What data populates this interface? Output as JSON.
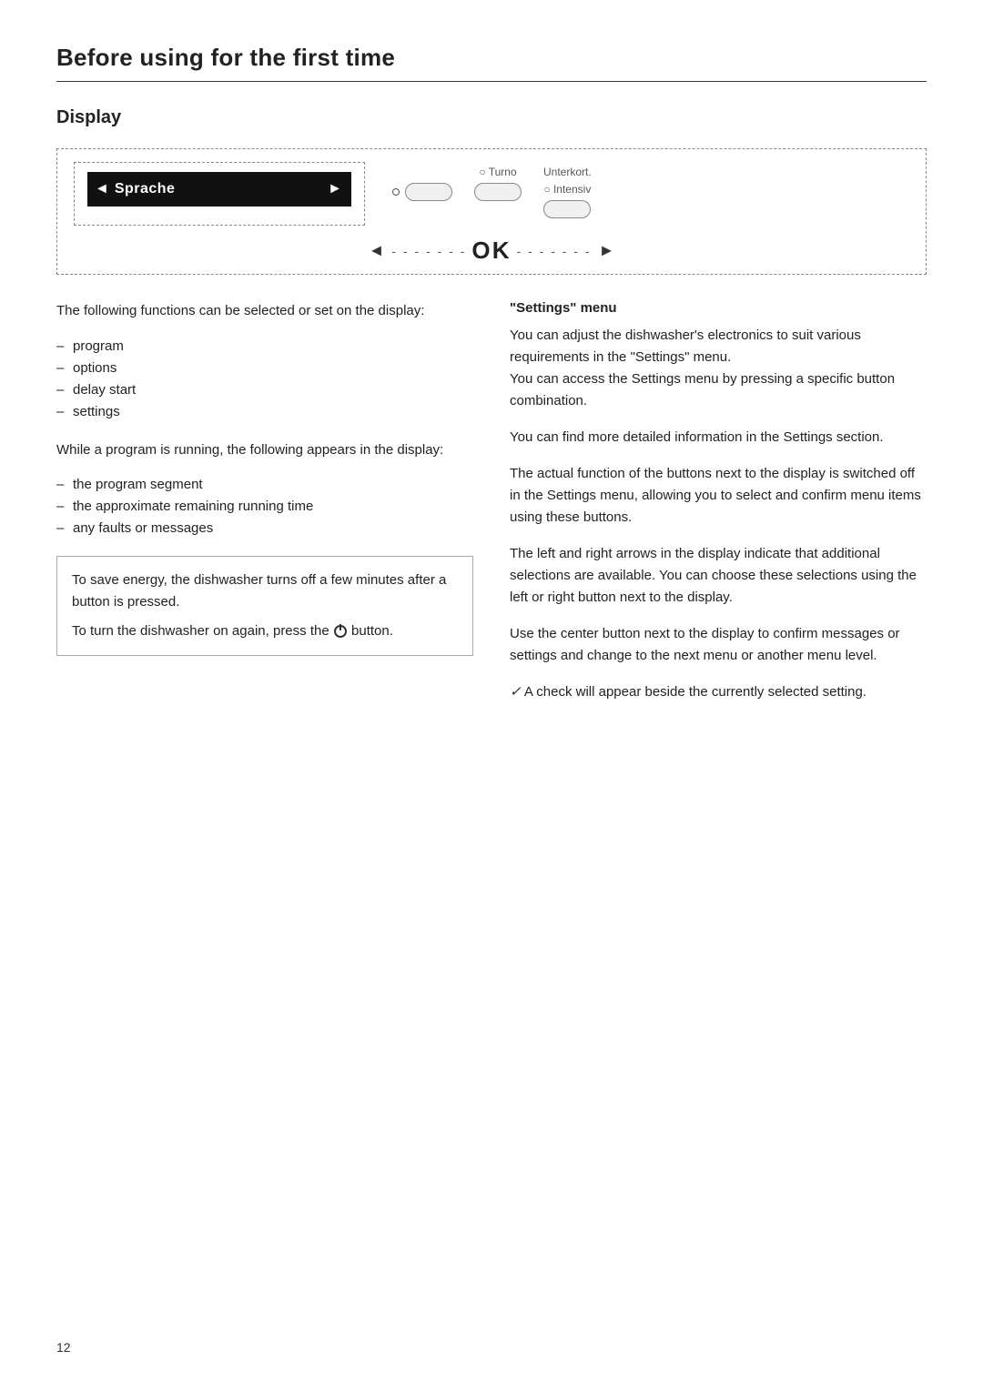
{
  "page": {
    "title": "Before using for the first time",
    "page_number": "12"
  },
  "display_section": {
    "title": "Display",
    "screen_text": "Sprache",
    "screen_arrow_left": "◄",
    "screen_arrow_right": "►",
    "ok_label": "OK",
    "ok_arrow_left": "◄",
    "ok_arrow_right": "►",
    "ok_dashes_left": "- - - - - - -",
    "ok_dashes_right": "- - - - - - -",
    "buttons": [
      {
        "label": "",
        "dot": true
      },
      {
        "label": "Turno",
        "dot": true
      },
      {
        "label": "Intensiv",
        "dot": true
      }
    ],
    "button_label_extra": "Unterkort."
  },
  "left_column": {
    "intro": "The following functions can be selected or set on the display:",
    "functions": [
      "program",
      "options",
      "delay start",
      "settings"
    ],
    "while_running_intro": "While a program is running, the following appears in the display:",
    "while_running_items": [
      "the program segment",
      "the approximate remaining running time",
      "any faults or messages"
    ],
    "info_box": {
      "line1": "To save energy, the dishwasher turns off a few minutes after a button is pressed.",
      "line2": "To turn the dishwasher on again, press the",
      "button_label": "button."
    }
  },
  "right_column": {
    "settings_menu_title": "\"Settings\" menu",
    "para1": "You can adjust the dishwasher's electronics to suit various requirements in the \"Settings\" menu.\nYou can access the Settings menu by pressing a specific button combination.",
    "para2": "You can find more detailed information in the Settings section.",
    "para3": "The actual function of the buttons next to the display is switched off in the Settings menu, allowing you to select and confirm menu items using these buttons.",
    "para4": "The left and right arrows in the display indicate that additional selections are available. You can choose these selections using the left or right button next to the display.",
    "para5": "Use the center button next to the display to confirm messages or settings and change to the next menu or another menu level.",
    "para6_check": "✓ A check will appear beside the currently selected setting."
  }
}
